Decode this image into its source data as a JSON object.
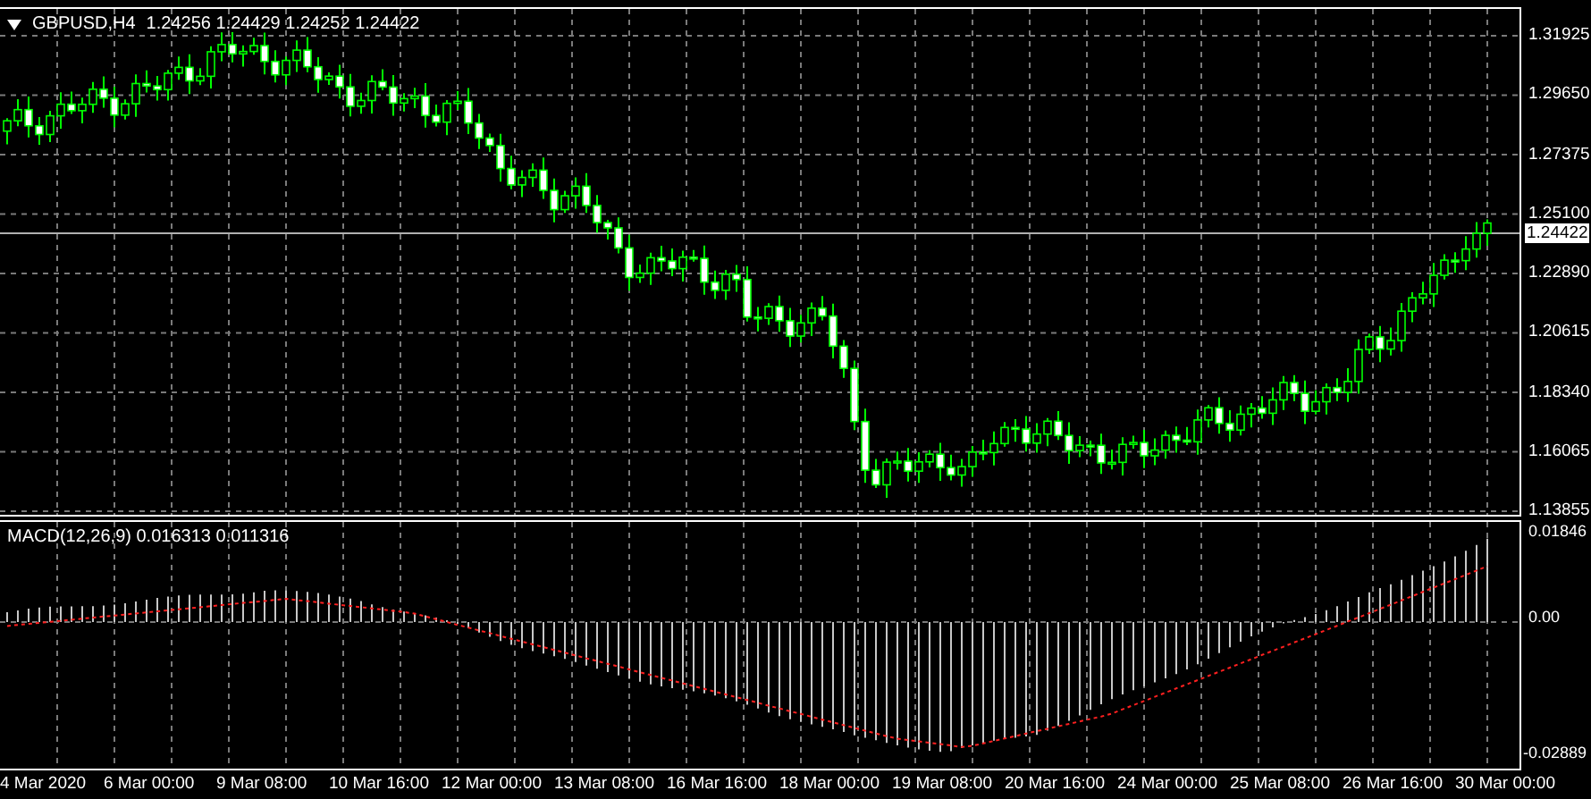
{
  "chart": {
    "symbol": "GBPUSD,H4",
    "ohlc": "1.24256 1.24429 1.24252 1.24422",
    "price_ticks": [
      "1.31925",
      "1.29650",
      "1.27375",
      "1.25100",
      "1.22890",
      "1.20615",
      "1.18340",
      "1.16065",
      "1.13855"
    ],
    "current_price": "1.24422"
  },
  "macd": {
    "label": "MACD(12,26,9) 0.016313 0.011316",
    "ticks": [
      "0.01846",
      "0.00",
      "-0.02889"
    ]
  },
  "time_axis": {
    "labels": [
      "4 Mar 2020",
      "6 Mar 00:00",
      "9 Mar 08:00",
      "10 Mar 16:00",
      "12 Mar 00:00",
      "13 Mar 08:00",
      "16 Mar 16:00",
      "18 Mar 00:00",
      "19 Mar 08:00",
      "20 Mar 16:00",
      "24 Mar 00:00",
      "25 Mar 08:00",
      "26 Mar 16:00",
      "30 Mar 00:00"
    ]
  }
}
